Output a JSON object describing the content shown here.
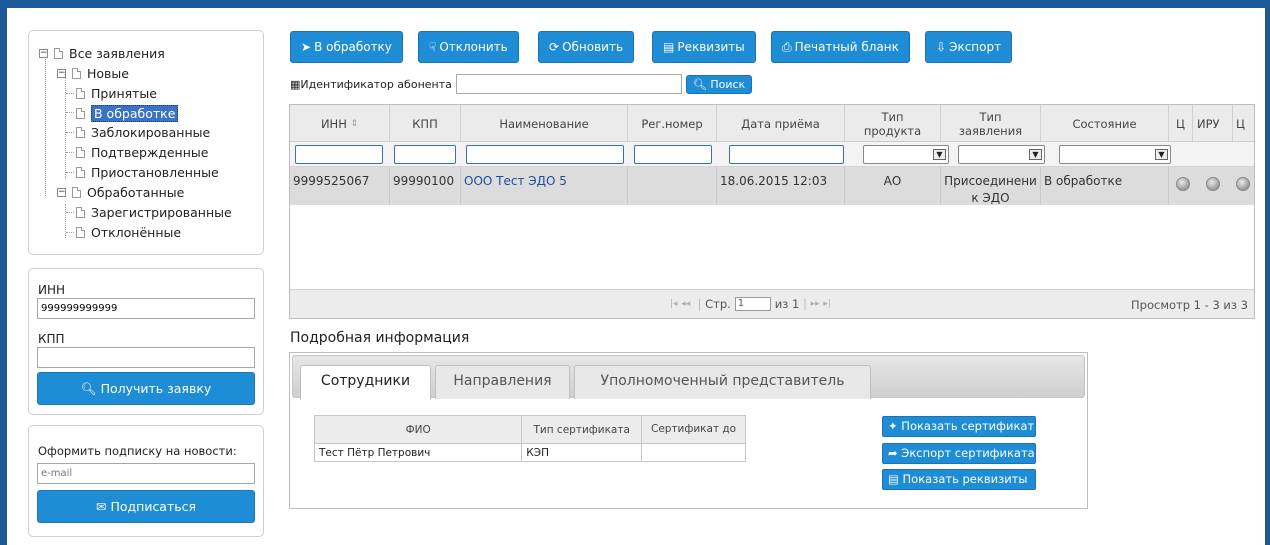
{
  "tree": {
    "root": "Все заявления",
    "new_group": "Новые",
    "new_items": [
      "Принятые",
      "В обработке",
      "Заблокированные",
      "Подтвержденные",
      "Приостановленные"
    ],
    "selected_index": 1,
    "processed_group": "Обработанные",
    "processed_items": [
      "Зарегистрированные",
      "Отклонённые"
    ]
  },
  "inn_panel": {
    "inn_label": "ИНН",
    "inn_value": "999999999999",
    "kpp_label": "КПП",
    "kpp_value": "",
    "get_button": "Получить заявку"
  },
  "subscribe": {
    "label": "Оформить подписку на новости:",
    "email_placeholder": "e-mail",
    "button": "Подписаться"
  },
  "toolbar": {
    "process": "В обработку",
    "reject": "Отклонить",
    "refresh": "Обновить",
    "requisites": "Реквизиты",
    "print": "Печатный бланк",
    "export": "Экспорт"
  },
  "search": {
    "label": "Идентификатор абонента",
    "value": "",
    "button": "Поиск"
  },
  "grid": {
    "headers": [
      "ИНН",
      "КПП",
      "Наименование",
      "Рег.номер",
      "Дата приёма",
      "Тип продукта",
      "Тип заявления",
      "Состояние",
      "Ц",
      "ИРУ",
      "Ц"
    ],
    "rows": [
      {
        "inn": "9999525067",
        "kpp": "99990100",
        "name": "ООО Тест ЭДО 5",
        "reg": "",
        "date": "18.06.2015 12:03",
        "product": "АО",
        "type": "Присоединени к ЭДО",
        "state": "В обработке"
      }
    ],
    "pager": {
      "page_label": "Стр.",
      "page_value": "1",
      "of_label": "из 1",
      "view_text": "Просмотр 1 - 3 из 3"
    }
  },
  "details": {
    "title": "Подробная информация",
    "tabs": [
      "Сотрудники",
      "Направления",
      "Уполномоченный представитель"
    ],
    "active_tab": 0,
    "table_headers": [
      "ФИО",
      "Тип сертификата",
      "Сертификат до"
    ],
    "table_rows": [
      [
        "Тест Пётр Петрович",
        "КЭП",
        ""
      ]
    ],
    "buttons": {
      "show_cert": "Показать сертификат",
      "export_cert": "Экспорт сертификата",
      "show_req": "Показать реквизиты"
    }
  },
  "colors": {
    "frame": "#1e5a98",
    "button": "#1f8dd6",
    "selected": "#3a73c4"
  }
}
